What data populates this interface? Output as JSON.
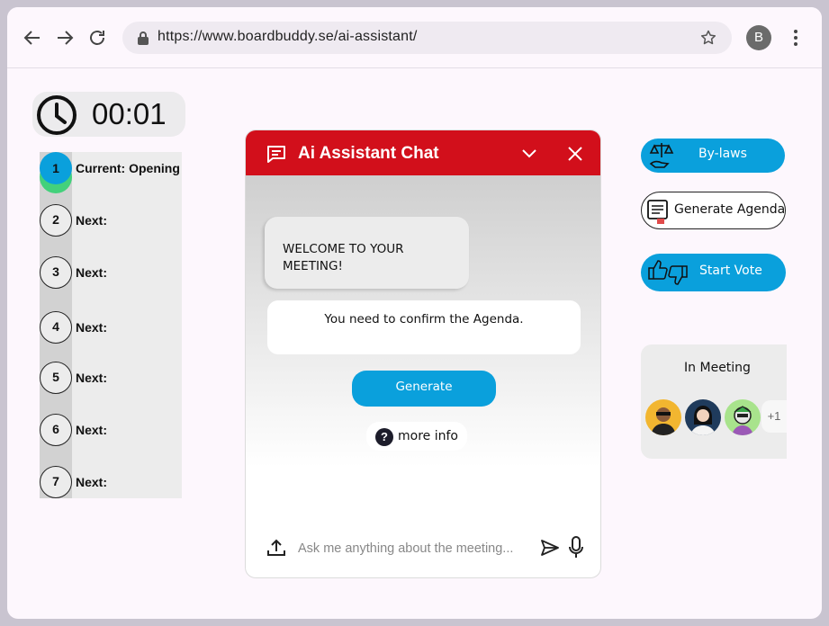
{
  "browser": {
    "url": "https://www.boardbuddy.se/ai-assistant/",
    "profile_initial": "B"
  },
  "timer": {
    "value": "00:01"
  },
  "agenda_steps": [
    {
      "number": "1",
      "label": "Current: Opening",
      "active": true
    },
    {
      "number": "2",
      "label": "Next:"
    },
    {
      "number": "3",
      "label": "Next:"
    },
    {
      "number": "4",
      "label": "Next:"
    },
    {
      "number": "5",
      "label": "Next:"
    },
    {
      "number": "6",
      "label": "Next:"
    },
    {
      "number": "7",
      "label": "Next:"
    }
  ],
  "chat": {
    "title": "Ai Assistant Chat",
    "welcome": "WELCOME TO YOUR MEETING!",
    "message": "You need to confirm the Agenda.",
    "generate_label": "Generate",
    "more_info_label": "more info",
    "input_placeholder": "Ask me anything about the meeting..."
  },
  "actions": {
    "bylaws_label": "By-laws",
    "generate_agenda_label": "Generate Agenda",
    "start_vote_label": "Start Vote"
  },
  "meeting": {
    "label": "In Meeting",
    "extra_count": "+1"
  },
  "colors": {
    "accent_blue": "#0aa0dc",
    "chat_header_red": "#d20f1b",
    "active_step_green": "#43d17b"
  }
}
